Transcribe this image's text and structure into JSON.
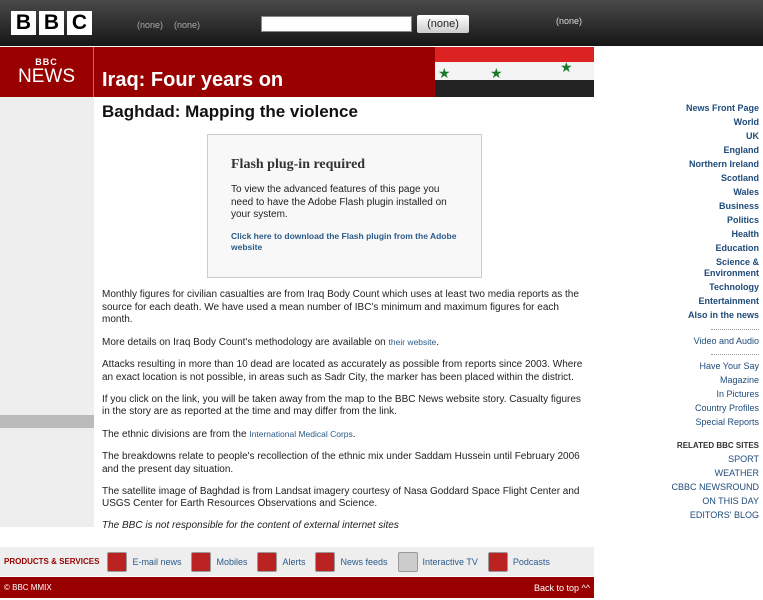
{
  "top": {
    "logo": [
      "B",
      "B",
      "C"
    ],
    "links": [
      "(none)",
      "(none)"
    ],
    "search_button": "(none)",
    "right_link": "(none)"
  },
  "banner": {
    "logo_small": "BBC",
    "logo_news": "NEWS",
    "title": "Iraq: Four years on"
  },
  "sidebar": {
    "main": [
      "News Front Page",
      "World",
      "UK",
      "England",
      "Northern Ireland",
      "Scotland",
      "Wales",
      "Business",
      "Politics",
      "Health",
      "Education",
      "Science &",
      "Environment",
      "Technology",
      "Entertainment",
      "Also in the news"
    ],
    "video": "Video and Audio",
    "secondary": [
      "Have Your Say",
      "Magazine",
      "In Pictures",
      "Country Profiles",
      "Special Reports"
    ],
    "related_heading": "RELATED BBC SITES",
    "related": [
      "SPORT",
      "WEATHER",
      "CBBC NEWSROUND",
      "ON THIS DAY",
      "EDITORS' BLOG"
    ]
  },
  "main": {
    "heading": "Baghdad: Mapping the violence",
    "flash": {
      "title": "Flash plug-in required",
      "text": "To view the advanced features of this page you need to have the Adobe Flash plugin installed on your system.",
      "link": "Click here to download the Flash plugin from the Adobe website"
    },
    "p1": "Monthly figures for civilian casualties are from Iraq Body Count which uses at least two media reports as the source for each death. We have used a mean number of IBC's minimum and maximum figures for each month.",
    "p2": "More details on Iraq Body Count's methodology are available on ",
    "p2_link": "their website",
    "dot": ".",
    "p3": "Attacks resulting in more than 10 dead are located as accurately as possible from reports since 2003. Where an exact location is not possible, in areas such as Sadr City, the marker has been placed within the district.",
    "p4": "If you click on the link, you will be taken away from the map to the BBC News website story. Casualty figures in the story are as reported at the time and may differ from the link.",
    "p5": "The ethnic divisions are from the ",
    "p5_link": "International Medical Corps",
    "p6": "The breakdowns relate to people's recollection of the ethnic mix under Saddam Hussein until February 2006 and the present day situation.",
    "p7": "The satellite image of Baghdad is from Landsat imagery courtesy of Nasa Goddard Space Flight Center and USGS Center for Earth Resources Observations and Science.",
    "disclaimer": "The BBC is not responsible for the content of external internet sites"
  },
  "products": {
    "label": "PRODUCTS & SERVICES",
    "items": [
      "E-mail news",
      "Mobiles",
      "Alerts",
      "News feeds",
      "Interactive TV",
      "Podcasts"
    ]
  },
  "footer": {
    "copyright": "© BBC MMIX",
    "back_to_top": "Back to top ^^"
  }
}
